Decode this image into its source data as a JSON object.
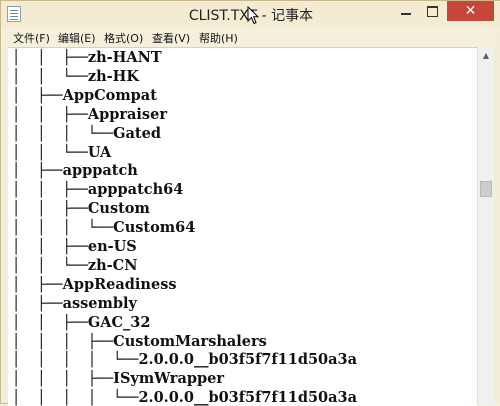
{
  "window": {
    "title": "CLIST.TXT - 记事本",
    "controls": {
      "minimize": "",
      "maximize": "",
      "close": "✕"
    }
  },
  "menu": [
    {
      "label": "文件(F)"
    },
    {
      "label": "编辑(E)"
    },
    {
      "label": "格式(O)"
    },
    {
      "label": "查看(V)"
    },
    {
      "label": "帮助(H)"
    }
  ],
  "tree_lines": [
    {
      "prefix": "│  │  ├──",
      "text": "zh-HANT"
    },
    {
      "prefix": "│  │  └──",
      "text": "zh-HK"
    },
    {
      "prefix": "│  ├──",
      "text": "AppCompat"
    },
    {
      "prefix": "│  │  ├──",
      "text": "Appraiser"
    },
    {
      "prefix": "│  │  │  └──",
      "text": "Gated"
    },
    {
      "prefix": "│  │  └──",
      "text": "UA"
    },
    {
      "prefix": "│  ├──",
      "text": "apppatch"
    },
    {
      "prefix": "│  │  ├──",
      "text": "apppatch64"
    },
    {
      "prefix": "│  │  ├──",
      "text": "Custom"
    },
    {
      "prefix": "│  │  │  └──",
      "text": "Custom64"
    },
    {
      "prefix": "│  │  ├──",
      "text": "en-US"
    },
    {
      "prefix": "│  │  └──",
      "text": "zh-CN"
    },
    {
      "prefix": "│  ├──",
      "text": "AppReadiness"
    },
    {
      "prefix": "│  ├──",
      "text": "assembly"
    },
    {
      "prefix": "│  │  ├──",
      "text": "GAC_32"
    },
    {
      "prefix": "│  │  │  ├──",
      "text": "CustomMarshalers"
    },
    {
      "prefix": "│  │  │  │  └──",
      "text": "2.0.0.0__b03f5f7f11d50a3a"
    },
    {
      "prefix": "│  │  │  ├──",
      "text": "ISymWrapper"
    },
    {
      "prefix": "│  │  │  │  └──",
      "text": "2.0.0.0__b03f5f7f11d50a3a"
    }
  ]
}
